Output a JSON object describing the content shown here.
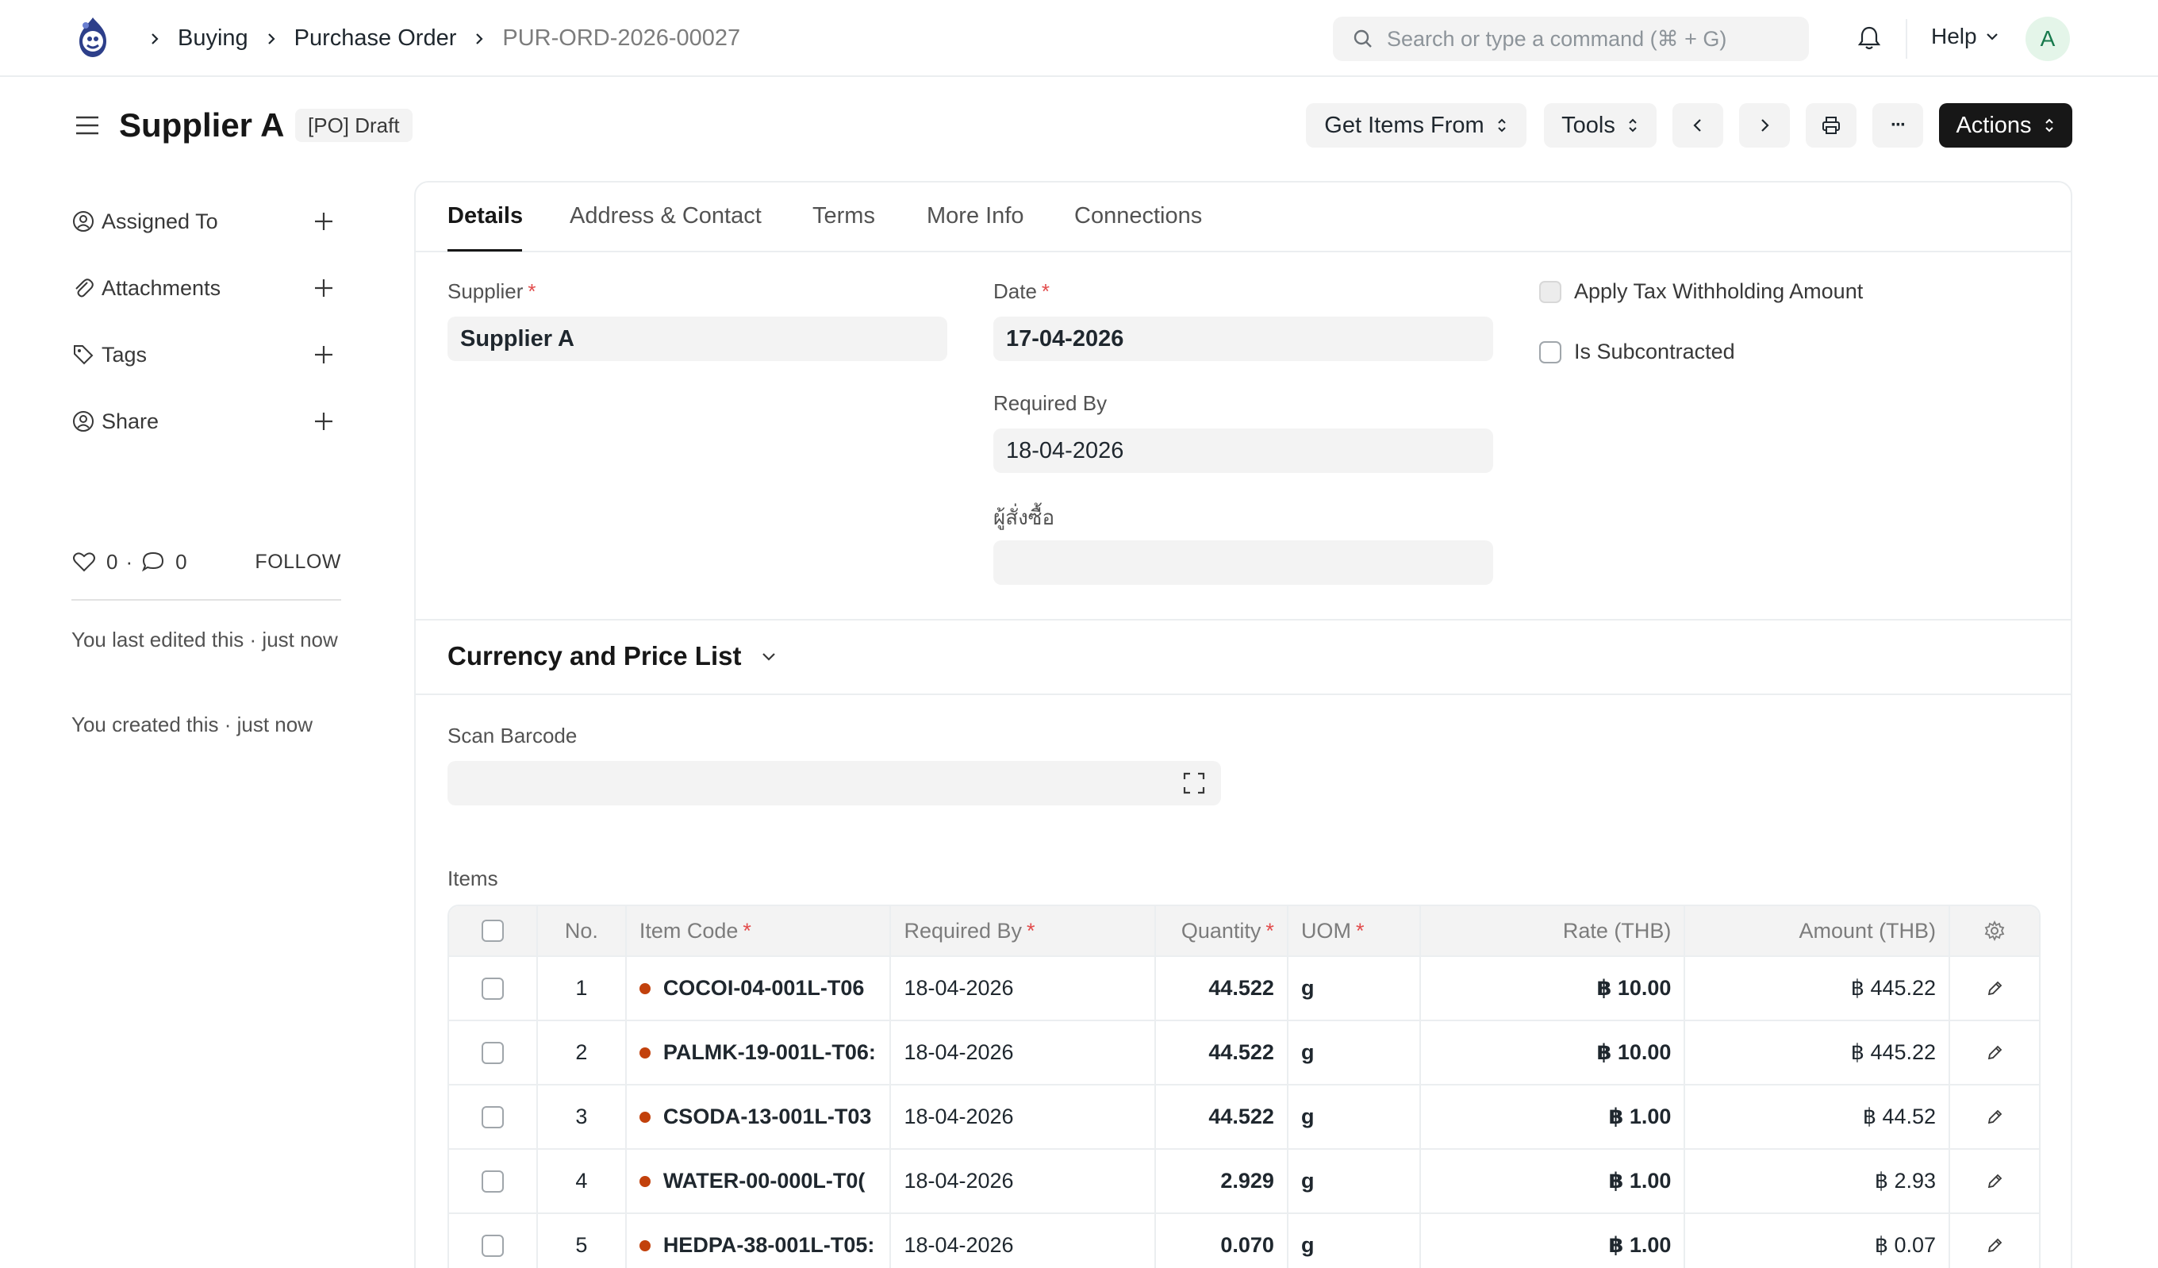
{
  "navbar": {
    "breadcrumbs": [
      "Buying",
      "Purchase Order",
      "PUR-ORD-2026-00027"
    ],
    "search_placeholder": "Search or type a command (⌘ + G)",
    "help_label": "Help",
    "avatar_initial": "A"
  },
  "header": {
    "title": "Supplier A",
    "status_badge": "[PO] Draft",
    "buttons": {
      "get_items_from": "Get Items From",
      "tools": "Tools",
      "actions": "Actions",
      "more": "···"
    }
  },
  "sidebar": {
    "items": [
      {
        "label": "Assigned To",
        "icon": "user-assign-icon"
      },
      {
        "label": "Attachments",
        "icon": "paperclip-icon"
      },
      {
        "label": "Tags",
        "icon": "tag-icon"
      },
      {
        "label": "Share",
        "icon": "share-user-icon"
      }
    ],
    "likes": "0",
    "dot": "·",
    "comments": "0",
    "follow_label": "FOLLOW",
    "activity": [
      "You last edited this · just now",
      "You created this · just now"
    ]
  },
  "tabs": [
    "Details",
    "Address & Contact",
    "Terms",
    "More Info",
    "Connections"
  ],
  "form": {
    "supplier_label": "Supplier",
    "supplier_value": "Supplier A",
    "date_label": "Date",
    "date_value": "17-04-2026",
    "required_by_label": "Required By",
    "required_by_value": "18-04-2026",
    "orderer_label": "ผู้สั่งซื้อ",
    "orderer_value": "",
    "apply_tax_label": "Apply Tax Withholding Amount",
    "is_subcontracted_label": "Is Subcontracted",
    "required_marker": "*"
  },
  "currency_section": {
    "title": "Currency and Price List"
  },
  "barcode": {
    "label": "Scan Barcode",
    "value": ""
  },
  "items_table": {
    "label": "Items",
    "headers": {
      "no": "No.",
      "item_code": "Item Code",
      "required_by": "Required By",
      "quantity": "Quantity",
      "uom": "UOM",
      "rate": "Rate (THB)",
      "amount": "Amount (THB)"
    },
    "rows": [
      {
        "no": "1",
        "item_code": "COCOI-04-001L-T06",
        "required_by": "18-04-2026",
        "quantity": "44.522",
        "uom": "g",
        "rate": "฿ 10.00",
        "amount": "฿ 445.22"
      },
      {
        "no": "2",
        "item_code": "PALMK-19-001L-T06:",
        "required_by": "18-04-2026",
        "quantity": "44.522",
        "uom": "g",
        "rate": "฿ 10.00",
        "amount": "฿ 445.22"
      },
      {
        "no": "3",
        "item_code": "CSODA-13-001L-T03",
        "required_by": "18-04-2026",
        "quantity": "44.522",
        "uom": "g",
        "rate": "฿ 1.00",
        "amount": "฿ 44.52"
      },
      {
        "no": "4",
        "item_code": "WATER-00-000L-T0(",
        "required_by": "18-04-2026",
        "quantity": "2.929",
        "uom": "g",
        "rate": "฿ 1.00",
        "amount": "฿ 2.93"
      },
      {
        "no": "5",
        "item_code": "HEDPA-38-001L-T05:",
        "required_by": "18-04-2026",
        "quantity": "0.070",
        "uom": "g",
        "rate": "฿ 1.00",
        "amount": "฿ 0.07"
      }
    ]
  },
  "colors": {
    "accent_dark": "#171717",
    "required_red": "#e24c4c",
    "item_dot": "#c2410c",
    "avatar_bg": "#e4f5e9",
    "avatar_text": "#16794c"
  }
}
